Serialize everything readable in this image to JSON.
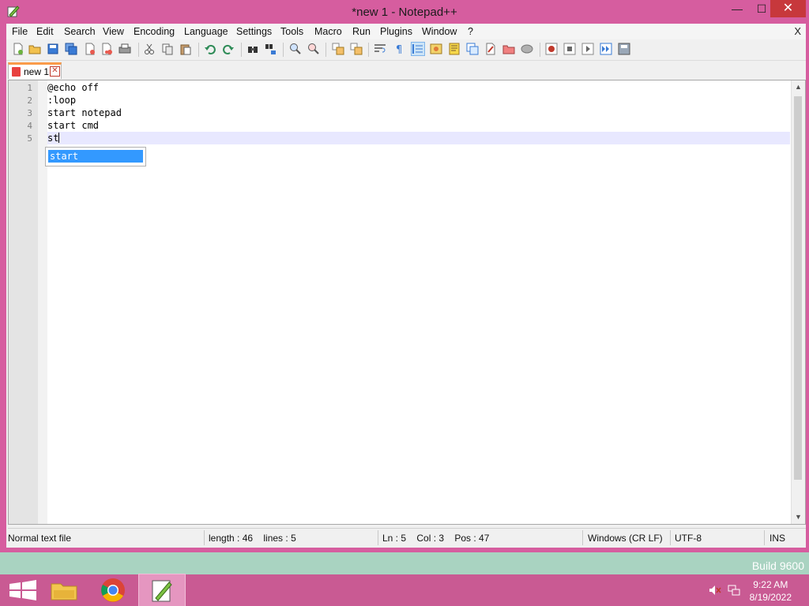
{
  "window": {
    "title": "*new 1 - Notepad++",
    "controls": {
      "minimize": "—",
      "maximize": "☐",
      "close": "✕"
    }
  },
  "menu": {
    "items": [
      "File",
      "Edit",
      "Search",
      "View",
      "Encoding",
      "Language",
      "Settings",
      "Tools",
      "Macro",
      "Run",
      "Plugins",
      "Window",
      "?"
    ],
    "close_doc": "X"
  },
  "toolbar": {
    "icons": [
      "new-file-icon",
      "open-file-icon",
      "save-icon",
      "save-all-icon",
      "close-icon",
      "close-all-icon",
      "print-icon",
      "cut-icon",
      "copy-icon",
      "paste-icon",
      "undo-icon",
      "redo-icon",
      "find-icon",
      "replace-icon",
      "zoom-in-icon",
      "zoom-out-icon",
      "sync-vertical-icon",
      "sync-horizontal-icon",
      "word-wrap-icon",
      "show-all-chars-icon",
      "indent-guide-icon",
      "udl-icon",
      "doc-map-icon",
      "function-list-icon",
      "folder-as-workspace-icon",
      "monitoring-icon",
      "record-macro-icon",
      "stop-macro-icon",
      "play-macro-icon",
      "run-macro-multiple-icon",
      "save-macro-icon"
    ]
  },
  "tabs": [
    {
      "label": "new 1"
    }
  ],
  "editor": {
    "line_numbers": [
      "1",
      "2",
      "3",
      "4",
      "5"
    ],
    "lines": [
      "@echo off",
      ":loop",
      "start notepad",
      "start cmd",
      "st"
    ],
    "autocomplete": [
      "start"
    ]
  },
  "status": {
    "file_type": "Normal text file",
    "length": "length : 46    lines : 5",
    "position": "Ln : 5    Col : 3    Pos : 47",
    "eol": "Windows (CR LF)",
    "encoding": "UTF-8",
    "mode": "INS"
  },
  "desktop": {
    "build": "Build 9600"
  },
  "taskbar": {
    "apps": [
      "start-button",
      "file-explorer-icon",
      "chrome-icon",
      "notepad-plus-plus-icon"
    ],
    "time": "9:22 AM",
    "date": "8/19/2022"
  },
  "colors": {
    "frame": "#d65d9f",
    "taskbar": "#c95a93",
    "selection": "#3399ff",
    "tab_accent": "#fa9b4a",
    "close_button": "#c7383c"
  }
}
